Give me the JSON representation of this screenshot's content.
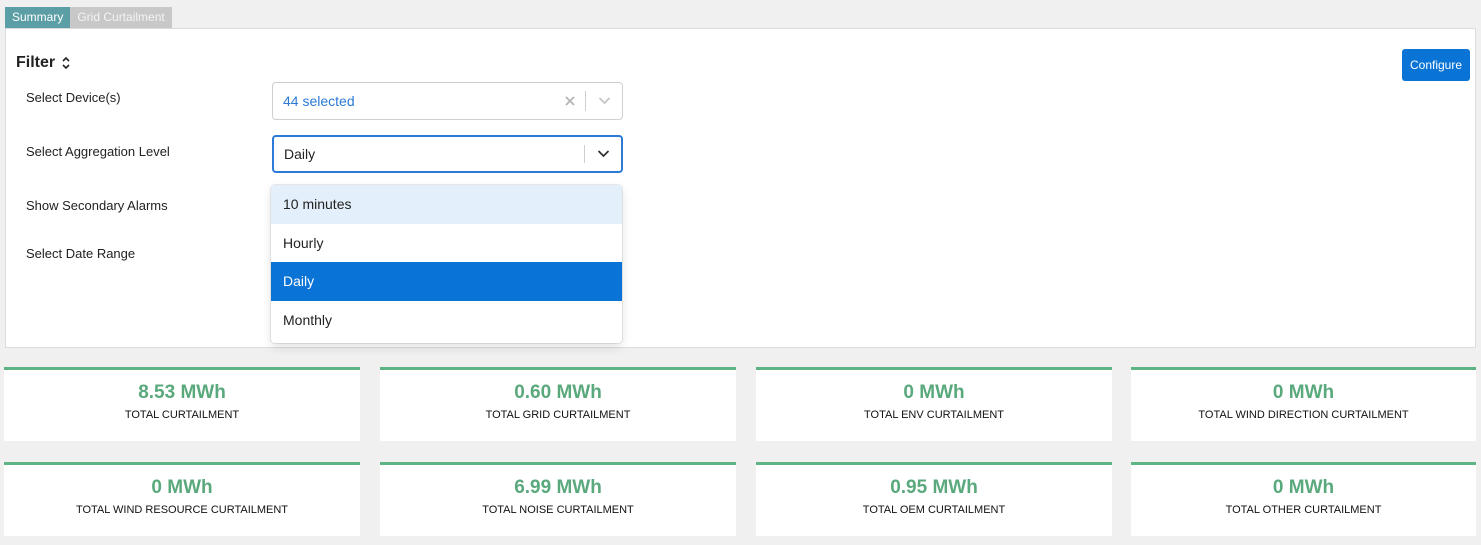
{
  "tabs": [
    {
      "label": "Summary",
      "active": true
    },
    {
      "label": "Grid Curtailment",
      "active": false
    }
  ],
  "filter": {
    "title": "Filter",
    "configure_label": "Configure",
    "fields": {
      "devices_label": "Select Device(s)",
      "devices_value": "44 selected",
      "aggregation_label": "Select Aggregation Level",
      "aggregation_value": "Daily",
      "secondary_alarms_label": "Show Secondary Alarms",
      "date_range_label": "Select Date Range"
    },
    "aggregation_options": [
      "10 minutes",
      "Hourly",
      "Daily",
      "Monthly"
    ],
    "aggregation_selected": "Daily",
    "aggregation_hovered": "10 minutes"
  },
  "cards": [
    {
      "value": "8.53 MWh",
      "label": "TOTAL CURTAILMENT"
    },
    {
      "value": "0.60 MWh",
      "label": "TOTAL GRID CURTAILMENT"
    },
    {
      "value": "0 MWh",
      "label": "TOTAL ENV CURTAILMENT"
    },
    {
      "value": "0 MWh",
      "label": "TOTAL WIND DIRECTION CURTAILMENT"
    },
    {
      "value": "0 MWh",
      "label": "TOTAL WIND RESOURCE CURTAILMENT"
    },
    {
      "value": "6.99 MWh",
      "label": "TOTAL NOISE CURTAILMENT"
    },
    {
      "value": "0.95 MWh",
      "label": "TOTAL OEM CURTAILMENT"
    },
    {
      "value": "0 MWh",
      "label": "TOTAL OTHER CURTAILMENT"
    }
  ],
  "colors": {
    "accent_blue": "#0a73d6",
    "card_green": "#5aa97d",
    "tab_active": "#5c9ea6"
  }
}
